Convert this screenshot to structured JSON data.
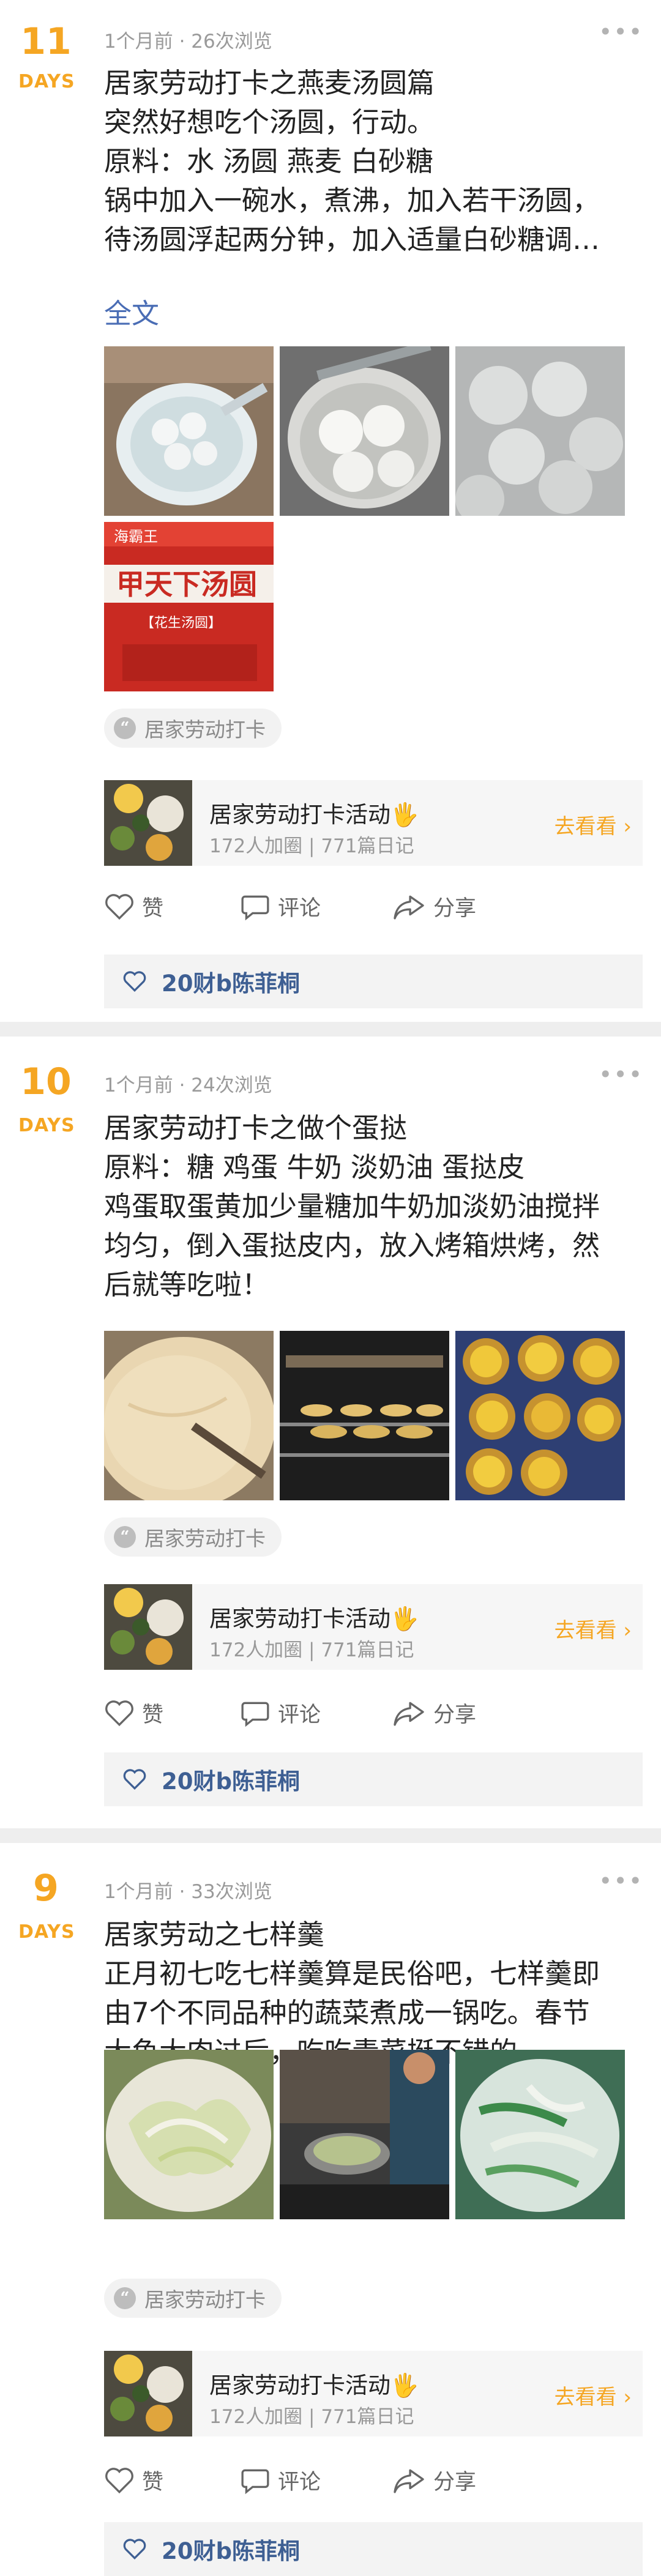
{
  "posts": [
    {
      "day": "11",
      "day_label": "DAYS",
      "meta": "1个月前 · 26次浏览",
      "lines": [
        "居家劳动打卡之燕麦汤圆篇",
        "突然好想吃个汤圆，行动。",
        "原料：水 汤圆 燕麦 白砂糖",
        "锅中加入一碗水，煮沸，加入若干汤圆，",
        "待汤圆浮起两分钟，加入适量白砂糖调…"
      ],
      "full_text_label": "全文",
      "tag": "居家劳动打卡",
      "activity": {
        "title": "居家劳动打卡活动🖐",
        "subtitle": "172人加圈 | 771篇日记",
        "go": "去看看"
      },
      "actions": {
        "like": "赞",
        "comment": "评论",
        "share": "分享"
      },
      "likes": "20财b陈菲桐"
    },
    {
      "day": "10",
      "day_label": "DAYS",
      "meta": "1个月前 · 24次浏览",
      "lines": [
        "居家劳动打卡之做个蛋挞",
        "原料：糖 鸡蛋 牛奶 淡奶油 蛋挞皮",
        "鸡蛋取蛋黄加少量糖加牛奶加淡奶油搅拌",
        "均匀，倒入蛋挞皮内，放入烤箱烘烤，然",
        "后就等吃啦！"
      ],
      "tag": "居家劳动打卡",
      "activity": {
        "title": "居家劳动打卡活动🖐",
        "subtitle": "172人加圈 | 771篇日记",
        "go": "去看看"
      },
      "actions": {
        "like": "赞",
        "comment": "评论",
        "share": "分享"
      },
      "likes": "20财b陈菲桐"
    },
    {
      "day": "9",
      "day_label": "DAYS",
      "meta": "1个月前 · 33次浏览",
      "lines": [
        "居家劳动之七样羹",
        "正月初七吃七样羹算是民俗吧，七样羹即",
        "由7个不同品种的蔬菜煮成一锅吃。春节",
        "大鱼大肉过后，吃吃青菜挺不错的。"
      ],
      "tag": "居家劳动打卡",
      "activity": {
        "title": "居家劳动打卡活动🖐",
        "subtitle": "172人加圈 | 771篇日记",
        "go": "去看看"
      },
      "actions": {
        "like": "赞",
        "comment": "评论",
        "share": "分享"
      },
      "likes": "20财b陈菲桐"
    }
  ],
  "images": {
    "post1": [
      "bowl-of-tangyuan-photo",
      "tangyuan-in-bowl-photo",
      "tangyuan-in-water-photo",
      "tangyuan-package-photo"
    ],
    "package_text": "甲天下汤圆",
    "package_brand": "海霸王",
    "package_sub": "【花生汤圆】",
    "post2": [
      "egg-custard-mixing-photo",
      "oven-tarts-photo",
      "baked-egg-tarts-photo"
    ],
    "post3": [
      "cabbage-plate-photo",
      "stove-cooking-photo",
      "vegetable-soup-photo"
    ]
  },
  "colors": {
    "accent": "#f5a623",
    "link": "#4a6db5",
    "likes": "#3e5f93"
  }
}
